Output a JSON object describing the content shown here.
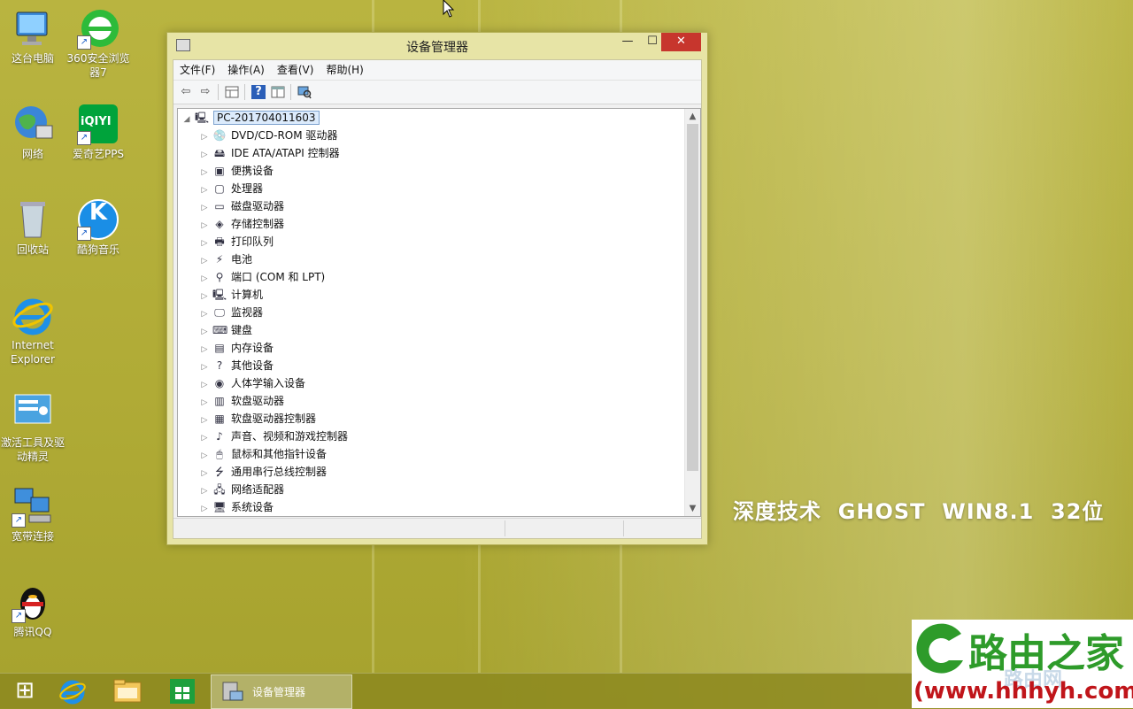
{
  "desktop": {
    "icons": [
      {
        "label": "这台电脑",
        "key": "computer"
      },
      {
        "label": "360安全浏览器7",
        "key": "browser360"
      },
      {
        "label": "网络",
        "key": "network"
      },
      {
        "label": "爱奇艺PPS",
        "key": "iqiyi"
      },
      {
        "label": "回收站",
        "key": "recycle"
      },
      {
        "label": "酷狗音乐",
        "key": "kugou"
      },
      {
        "label": "Internet Explorer",
        "key": "ie"
      },
      {
        "label": "激活工具及驱动精灵",
        "key": "activator"
      },
      {
        "label": "宽带连接",
        "key": "broadband"
      },
      {
        "label": "腾讯QQ",
        "key": "qq"
      }
    ],
    "watermark": "深度技术  GHOST  WIN8.1  32位",
    "iqiyi_text": "iQIYI",
    "kugou_letter": "K"
  },
  "window": {
    "title": "设备管理器",
    "controls": {
      "minimize": "—",
      "maximize": "☐",
      "close": "✕"
    },
    "menu": [
      "文件(F)",
      "操作(A)",
      "查看(V)",
      "帮助(H)"
    ],
    "toolbar": {
      "back": "⇦",
      "forward": "⇨",
      "help": "?"
    },
    "tree": {
      "root": "PC-201704011603",
      "items": [
        {
          "label": "DVD/CD-ROM 驱动器",
          "icon": "💿"
        },
        {
          "label": "IDE ATA/ATAPI 控制器",
          "icon": "🖴"
        },
        {
          "label": "便携设备",
          "icon": "▣"
        },
        {
          "label": "处理器",
          "icon": "▢"
        },
        {
          "label": "磁盘驱动器",
          "icon": "▭"
        },
        {
          "label": "存储控制器",
          "icon": "◈"
        },
        {
          "label": "打印队列",
          "icon": "🖶"
        },
        {
          "label": "电池",
          "icon": "⚡"
        },
        {
          "label": "端口 (COM 和 LPT)",
          "icon": "⚲"
        },
        {
          "label": "计算机",
          "icon": "🖳"
        },
        {
          "label": "监视器",
          "icon": "🖵"
        },
        {
          "label": "键盘",
          "icon": "⌨"
        },
        {
          "label": "内存设备",
          "icon": "▤"
        },
        {
          "label": "其他设备",
          "icon": "?"
        },
        {
          "label": "人体学输入设备",
          "icon": "◉"
        },
        {
          "label": "软盘驱动器",
          "icon": "▥"
        },
        {
          "label": "软盘驱动器控制器",
          "icon": "▦"
        },
        {
          "label": "声音、视频和游戏控制器",
          "icon": "♪"
        },
        {
          "label": "鼠标和其他指针设备",
          "icon": "🖱"
        },
        {
          "label": "通用串行总线控制器",
          "icon": "⭍"
        },
        {
          "label": "网络适配器",
          "icon": "🖧"
        },
        {
          "label": "系统设备",
          "icon": "🖥"
        }
      ]
    }
  },
  "taskbar": {
    "start_icon": "⊞",
    "active_task": "设备管理器"
  },
  "brand": {
    "name": "路由之家",
    "url_display": "(www.hhhyh.com)",
    "sub": "路由网"
  },
  "colors": {
    "accent_close": "#c7362d",
    "desktop": "#b5b03a",
    "brand_green": "#2e9b2a",
    "brand_red": "#c0151a"
  }
}
